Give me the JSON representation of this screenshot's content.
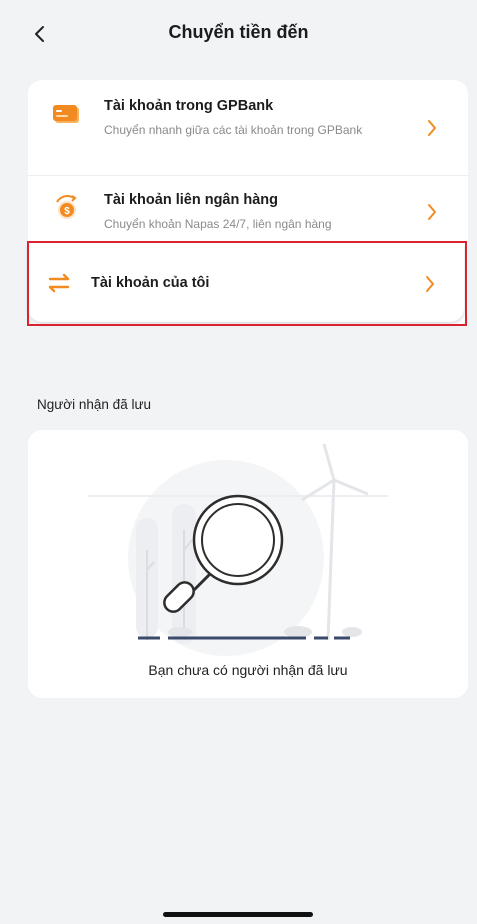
{
  "header": {
    "title": "Chuyển tiền đến",
    "back_icon": "chevron-left-icon"
  },
  "menu": {
    "items": [
      {
        "title": "Tài khoản trong GPBank",
        "subtitle": "Chuyển nhanh giữa các tài khoản trong GPBank",
        "icon": "card-icon"
      },
      {
        "title": "Tài khoản liên ngân hàng",
        "subtitle": "Chuyển khoản Napas 24/7, liên ngân hàng",
        "icon": "exchange-money-icon"
      },
      {
        "title": "Tài khoản của tôi",
        "icon": "transfer-arrows-icon"
      }
    ]
  },
  "saved_recipients": {
    "title": "Người nhận đã lưu",
    "empty_text": "Bạn chưa có người nhận đã lưu"
  },
  "colors": {
    "accent": "#f28a22",
    "highlight": "#d9242f",
    "background": "#f2f3f5"
  }
}
